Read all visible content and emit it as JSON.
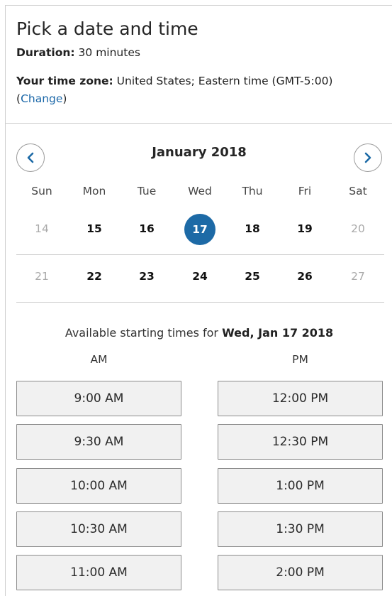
{
  "header": {
    "title": "Pick a date and time",
    "duration_label": "Duration:",
    "duration_value": "30 minutes",
    "timezone_label": "Your time zone:",
    "timezone_value": "United States;  Eastern time  (GMT-5:00)",
    "change_open": "(",
    "change_link": "Change",
    "change_close": ")"
  },
  "calendar": {
    "month_label": "January 2018",
    "prev_icon": "chevron-left-icon",
    "next_icon": "chevron-right-icon",
    "weekdays": [
      "Sun",
      "Mon",
      "Tue",
      "Wed",
      "Thu",
      "Fri",
      "Sat"
    ],
    "week1": [
      "14",
      "15",
      "16",
      "17",
      "18",
      "19",
      "20"
    ],
    "week2": [
      "21",
      "22",
      "23",
      "24",
      "25",
      "26",
      "27"
    ],
    "selected_day": "17"
  },
  "times": {
    "available_prefix": "Available starting times for",
    "available_date": "Wed, Jan 17 2018",
    "am_label": "AM",
    "pm_label": "PM",
    "am": [
      "9:00 AM",
      "9:30 AM",
      "10:00 AM",
      "10:30 AM",
      "11:00 AM"
    ],
    "pm": [
      "12:00 PM",
      "12:30 PM",
      "1:00 PM",
      "1:30 PM",
      "2:00 PM"
    ]
  },
  "colors": {
    "accent": "#1d6aa6",
    "link": "#1a67a8"
  }
}
